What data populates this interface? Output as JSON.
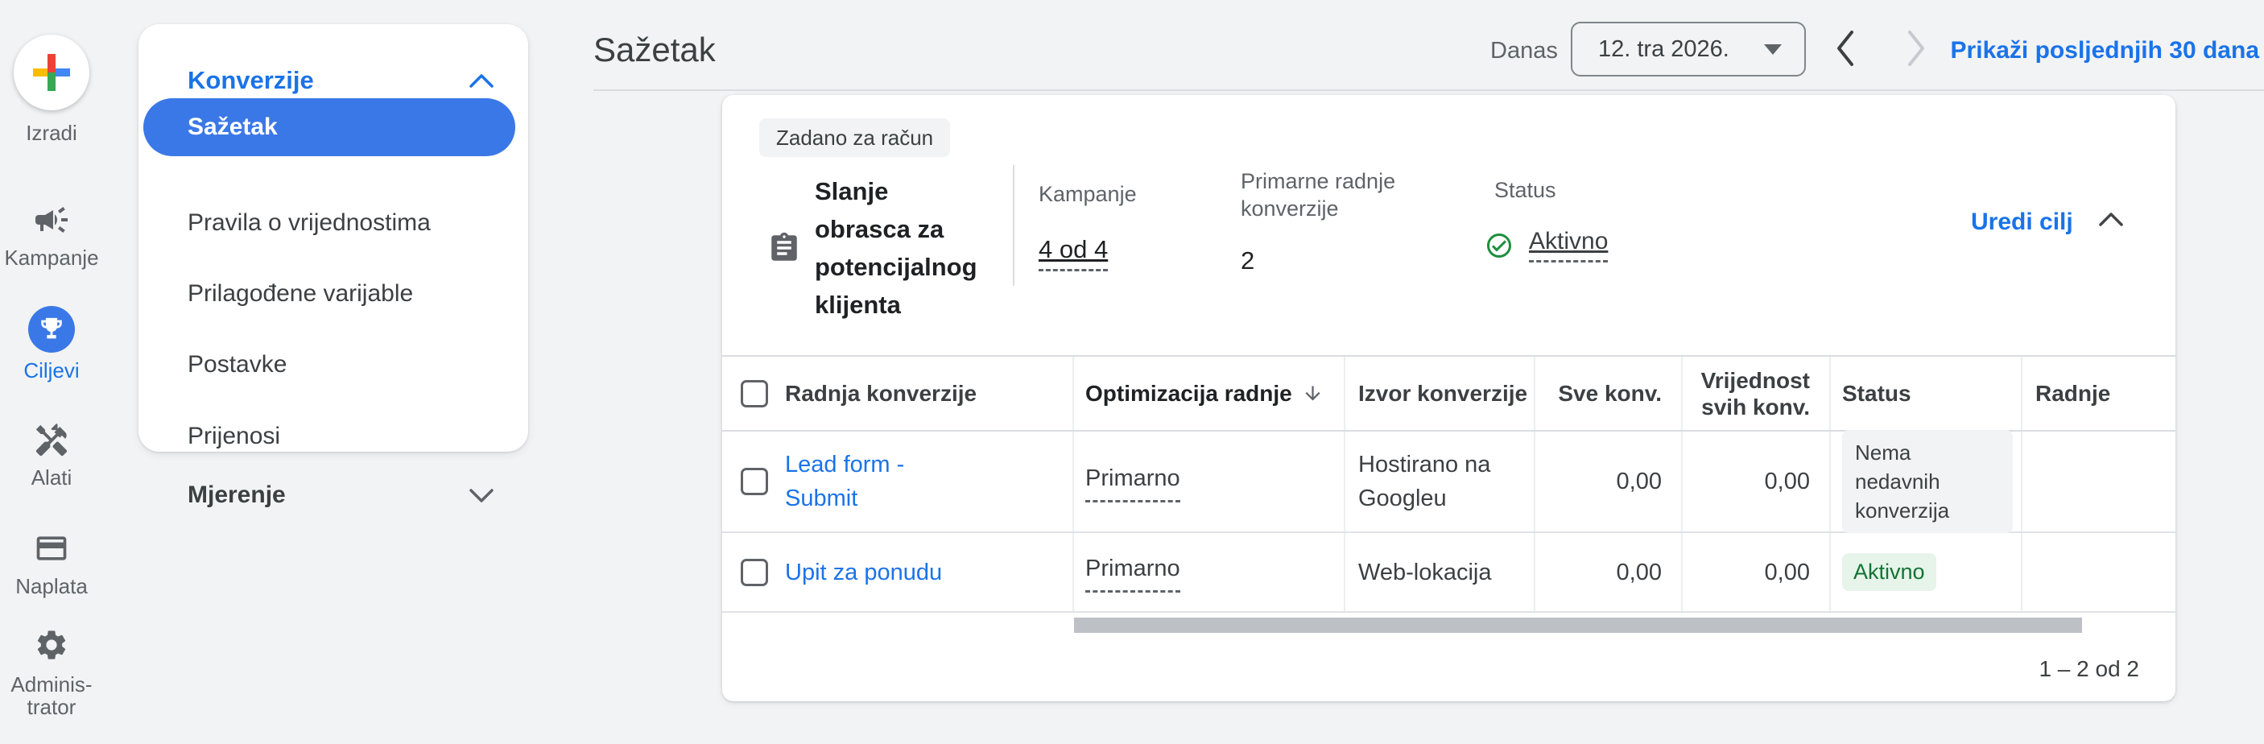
{
  "colors": {
    "accent_blue": "#1a73e8",
    "selected_pill_blue": "#3b78e7",
    "active_chip_text_green": "#137333",
    "active_chip_bg_green": "#e6f4ea",
    "status_check_green": "#1e8e3e",
    "page_bg": "#f1f3f4",
    "divider": "#dadce0"
  },
  "rail": {
    "create_label": "Izradi",
    "items": [
      {
        "label": "Kampanje",
        "icon": "megaphone-icon"
      },
      {
        "label": "Ciljevi",
        "icon": "trophy-icon",
        "active": true
      },
      {
        "label": "Alati",
        "icon": "tools-icon"
      },
      {
        "label": "Naplata",
        "icon": "credit-card-icon"
      },
      {
        "label": "Adminis-\ntrator",
        "icon": "gear-icon"
      }
    ]
  },
  "subnav": {
    "section_label": "Konverzije",
    "items": [
      "Sažetak",
      "Pravila o vrijednostima",
      "Prilagođene varijable",
      "Postavke",
      "Prijenosi"
    ],
    "active_item": "Sažetak",
    "collapsed_section_label": "Mjerenje"
  },
  "header": {
    "title": "Sažetak",
    "date_label": "Danas",
    "date_value": "12. tra 2026.",
    "show_last_label": "Prikaži posljednjih 30 dana"
  },
  "goal": {
    "badge": "Zadano za račun",
    "title": "Slanje obrasca za potencijalnog klijenta",
    "campaigns_label": "Kampanje",
    "campaigns_value": "4 od 4",
    "primary_actions_label_line1": "Primarne radnje",
    "primary_actions_label_line2": "konverzije",
    "primary_actions_value": "2",
    "status_label": "Status",
    "status_value": "Aktivno",
    "edit_label": "Uredi cilj"
  },
  "table": {
    "columns": [
      "Radnja konverzije",
      "Optimizacija radnje",
      "Izvor konverzije",
      "Sve konv.",
      "Vrijednost svih konv.",
      "Status",
      "Radnje"
    ],
    "sorted_column": "Optimizacija radnje",
    "sort_direction": "desc",
    "rows": [
      {
        "name": "Lead form - Submit",
        "optimization": "Primarno",
        "source": "Hostirano na Googleu",
        "all_conversions": "0,00",
        "all_conversions_value": "0,00",
        "status": "Nema nedavnih konverzija",
        "status_type": "none"
      },
      {
        "name": "Upit za ponudu",
        "optimization": "Primarno",
        "source": "Web-lokacija",
        "all_conversions": "0,00",
        "all_conversions_value": "0,00",
        "status": "Aktivno",
        "status_type": "active"
      }
    ],
    "pagination": "1 – 2 od 2"
  }
}
